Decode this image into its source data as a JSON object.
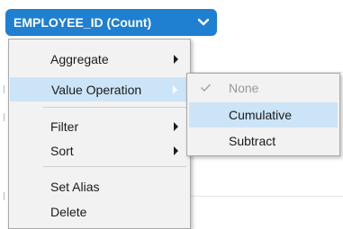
{
  "field_pill": {
    "label": "EMPLOYEE_ID (Count)",
    "icon": "chevron-down-icon",
    "color": "#1f7fd1"
  },
  "context_menu": {
    "items": [
      {
        "label": "Aggregate",
        "has_submenu": true
      },
      {
        "label": "Value Operation",
        "has_submenu": true,
        "highlighted": true
      },
      {
        "label": "Filter",
        "has_submenu": true
      },
      {
        "label": "Sort",
        "has_submenu": true
      },
      {
        "label": "Set Alias",
        "has_submenu": false
      },
      {
        "label": "Delete",
        "has_submenu": false
      }
    ]
  },
  "value_operation_submenu": {
    "items": [
      {
        "label": "None",
        "checked": true,
        "disabled": true
      },
      {
        "label": "Cumulative",
        "highlighted": true
      },
      {
        "label": "Subtract"
      }
    ]
  },
  "highlight_color": "#cce4f7"
}
